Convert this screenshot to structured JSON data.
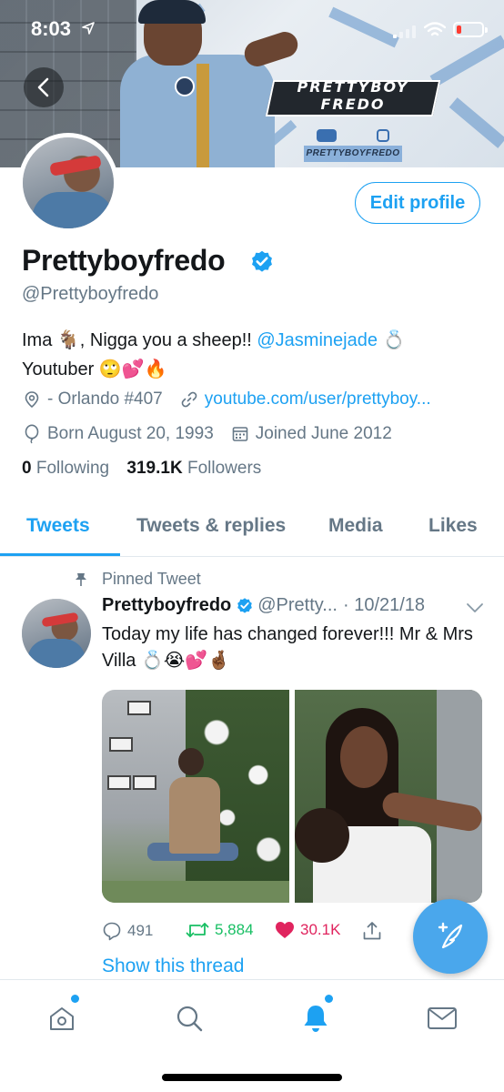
{
  "status_bar": {
    "time": "8:03"
  },
  "banner": {
    "brand_line1": "PRETTYBOY",
    "brand_line2": "FREDO",
    "brand_handle": "PRETTYBOYFREDO"
  },
  "profile": {
    "edit_profile_label": "Edit profile",
    "display_name": "Prettyboyfredo",
    "handle": "@Prettyboyfredo",
    "bio_part1": "Ima 🐐, Nigga you a sheep!! ",
    "bio_mention": "@Jasminejade",
    "bio_part2": " 💍 Youtuber 🙄💕🔥",
    "location": "- Orlando #407",
    "website": "youtube.com/user/prettyboy...",
    "birthday": "Born August 20, 1993",
    "joined": "Joined June 2012",
    "following_count": "0",
    "following_label": "Following",
    "followers_count": "319.1K",
    "followers_label": "Followers"
  },
  "tabs": [
    {
      "label": "Tweets",
      "active": true
    },
    {
      "label": "Tweets & replies",
      "active": false
    },
    {
      "label": "Media",
      "active": false
    },
    {
      "label": "Likes",
      "active": false
    }
  ],
  "tweet": {
    "pinned_label": "Pinned Tweet",
    "author_name": "Prettyboyfredo",
    "author_handle": "@Pretty...",
    "date": "· 10/21/18",
    "text": "Today my life has changed forever!!! Mr & Mrs Villa 💍😭💕🤞🏾",
    "replies": "491",
    "retweets": "5,884",
    "likes": "30.1K",
    "show_thread": "Show this thread"
  },
  "colors": {
    "accent": "#1da1f2",
    "retweet": "#17bf63",
    "like": "#e0245e",
    "muted": "#657786",
    "text": "#14171a"
  },
  "icons": {
    "back": "chevron-left-icon",
    "location": "location-pin-icon",
    "link": "link-icon",
    "birthday": "balloon-icon",
    "calendar": "calendar-icon",
    "pin": "pin-icon",
    "verified": "verified-badge-icon",
    "reply": "reply-icon",
    "retweet": "retweet-icon",
    "like": "heart-icon",
    "share": "share-icon",
    "compose": "compose-tweet-icon",
    "home": "home-icon",
    "search": "search-icon",
    "notifications": "bell-icon",
    "messages": "mail-icon"
  }
}
